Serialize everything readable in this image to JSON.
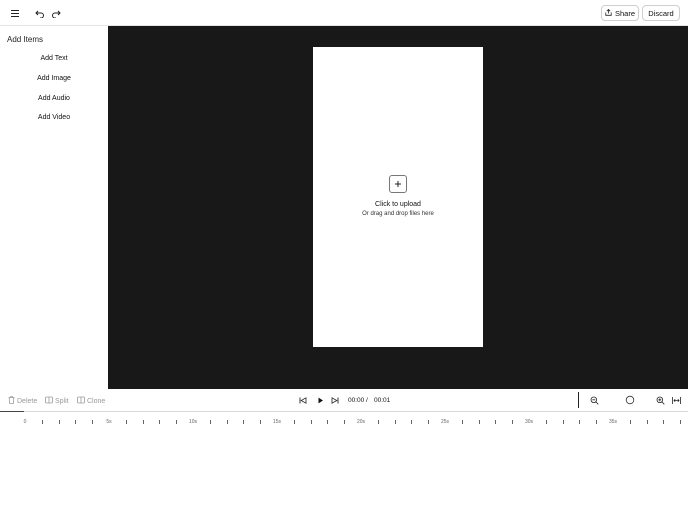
{
  "topbar": {
    "share_label": "Share",
    "discard_label": "Discard"
  },
  "sidebar": {
    "title": "Add Items",
    "items": [
      {
        "label": "Add Text"
      },
      {
        "label": "Add Image"
      },
      {
        "label": "Add Audio"
      },
      {
        "label": "Add Video"
      }
    ]
  },
  "canvas": {
    "upload_title": "Click to upload",
    "upload_subtitle": "Or drag and drop files here"
  },
  "toolbar": {
    "delete_label": "Delete",
    "split_label": "Split",
    "clone_label": "Clone",
    "current_time": "00:00",
    "separator": "/",
    "total_time": "00:01"
  },
  "timeline": {
    "labels": [
      "0",
      "5s",
      "10s",
      "15s",
      "20s",
      "25s",
      "30s",
      "35s"
    ]
  }
}
